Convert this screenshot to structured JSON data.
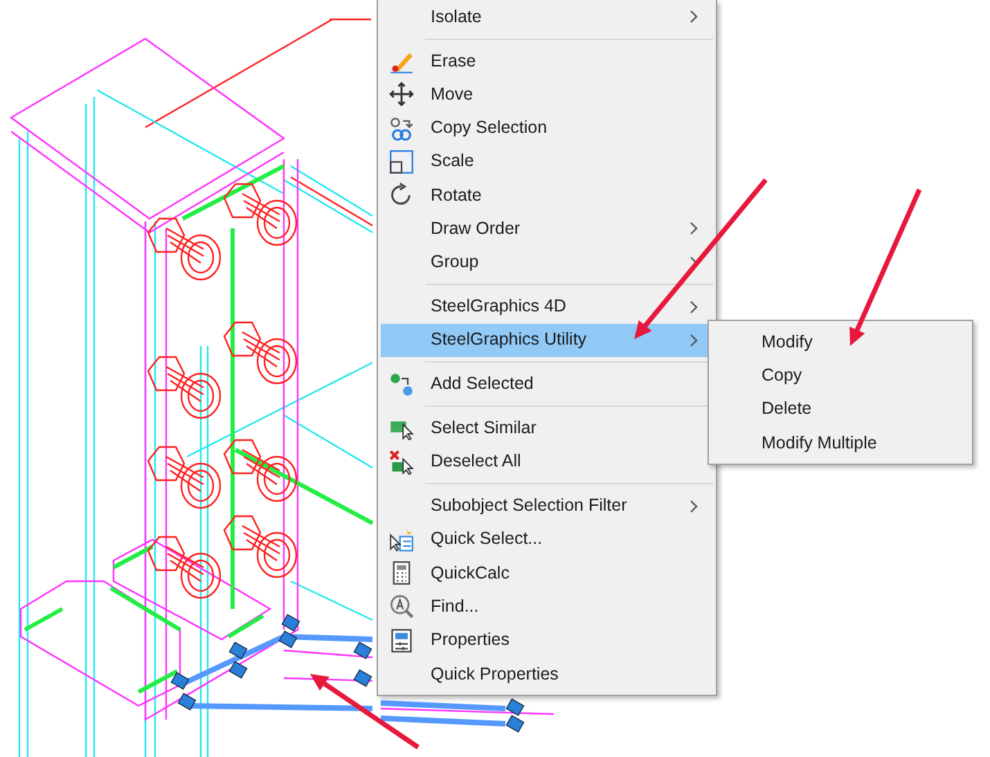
{
  "context_menu": {
    "items": [
      {
        "kind": "item",
        "label": "Isolate",
        "has_submenu": true,
        "selected": false
      },
      {
        "kind": "separator"
      },
      {
        "kind": "item",
        "label": "Erase",
        "has_submenu": false,
        "selected": false
      },
      {
        "kind": "item",
        "label": "Move",
        "has_submenu": false,
        "selected": false
      },
      {
        "kind": "item",
        "label": "Copy Selection",
        "has_submenu": false,
        "selected": false
      },
      {
        "kind": "item",
        "label": "Scale",
        "has_submenu": false,
        "selected": false
      },
      {
        "kind": "item",
        "label": "Rotate",
        "has_submenu": false,
        "selected": false
      },
      {
        "kind": "item",
        "label": "Draw Order",
        "has_submenu": true,
        "selected": false
      },
      {
        "kind": "item",
        "label": "Group",
        "has_submenu": true,
        "selected": false
      },
      {
        "kind": "separator"
      },
      {
        "kind": "item",
        "label": "SteelGraphics 4D",
        "has_submenu": true,
        "selected": false
      },
      {
        "kind": "item",
        "label": "SteelGraphics Utility",
        "has_submenu": true,
        "selected": true
      },
      {
        "kind": "separator"
      },
      {
        "kind": "item",
        "label": "Add Selected",
        "has_submenu": false,
        "selected": false
      },
      {
        "kind": "separator"
      },
      {
        "kind": "item",
        "label": "Select Similar",
        "has_submenu": false,
        "selected": false
      },
      {
        "kind": "item",
        "label": "Deselect All",
        "has_submenu": false,
        "selected": false
      },
      {
        "kind": "separator"
      },
      {
        "kind": "item",
        "label": "Subobject Selection Filter",
        "has_submenu": true,
        "selected": false
      },
      {
        "kind": "item",
        "label": "Quick Select...",
        "has_submenu": false,
        "selected": false
      },
      {
        "kind": "item",
        "label": "QuickCalc",
        "has_submenu": false,
        "selected": false
      },
      {
        "kind": "item",
        "label": "Find...",
        "has_submenu": false,
        "selected": false
      },
      {
        "kind": "item",
        "label": "Properties",
        "has_submenu": false,
        "selected": false
      },
      {
        "kind": "item",
        "label": "Quick Properties",
        "has_submenu": false,
        "selected": false
      }
    ]
  },
  "submenu": {
    "items": [
      {
        "label": "Modify",
        "selected": false
      },
      {
        "label": "Copy",
        "selected": false
      },
      {
        "label": "Delete",
        "selected": false
      },
      {
        "label": "Modify Multiple",
        "selected": false
      }
    ]
  }
}
